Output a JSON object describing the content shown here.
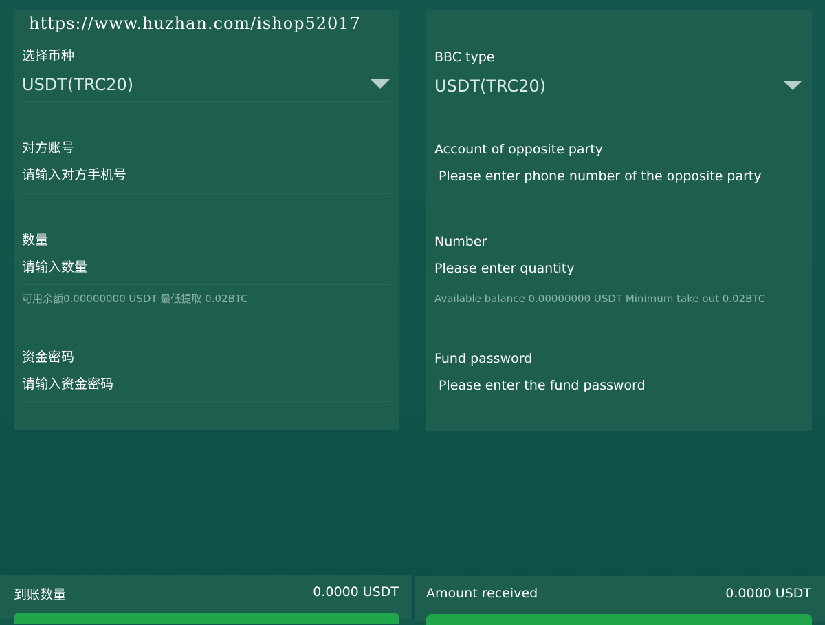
{
  "watermark": "https://www.huzhan.com/ishop52017",
  "left": {
    "currency_label": "选择币种",
    "currency_value": "USDT(TRC20)",
    "account_label": "对方账号",
    "account_placeholder": "请输入对方手机号",
    "quantity_label": "数量",
    "quantity_placeholder": "请输入数量",
    "balance_hint": "可用余额0.00000000 USDT 最低提取 0.02BTC",
    "password_label": "资金密码",
    "password_placeholder": "请输入资金密码",
    "received_label": "到账数量",
    "received_amount": "0.0000 USDT"
  },
  "right": {
    "currency_label": "BBC type",
    "currency_value": "USDT(TRC20)",
    "account_label": "Account of opposite party",
    "account_placeholder": "Please enter phone number of the opposite party",
    "quantity_label": "Number",
    "quantity_placeholder": "Please enter quantity",
    "balance_hint": "Available balance 0.00000000 USDT Minimum take out 0.02BTC",
    "password_label": "Fund password",
    "password_placeholder": "Please enter the fund password",
    "received_label": "Amount received",
    "received_amount": "0.0000 USDT"
  },
  "colors": {
    "background": "#0d5049",
    "panel": "#1d5e4e",
    "button": "#1fa54a",
    "hint": "#8fb5ab"
  },
  "icons": {
    "dropdown": "chevron-down-icon"
  }
}
